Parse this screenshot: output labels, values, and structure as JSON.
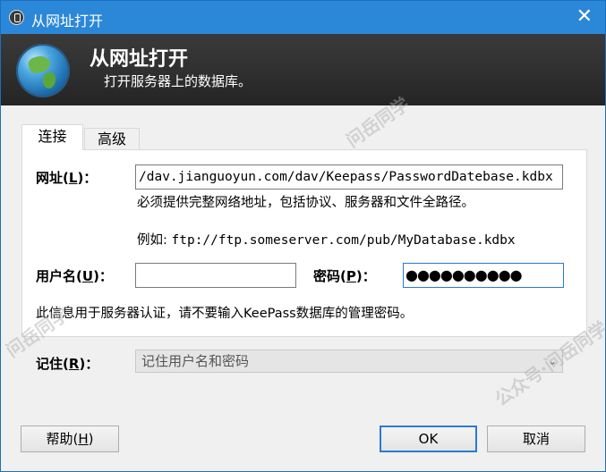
{
  "window": {
    "title": "从网址打开",
    "close_glyph": "✕"
  },
  "banner": {
    "heading": "从网址打开",
    "subheading": "打开服务器上的数据库。"
  },
  "tabs": [
    {
      "label": "连接"
    },
    {
      "label": "高级"
    }
  ],
  "form": {
    "url_label": "网址",
    "url_key": "L",
    "url_value": "/dav.jianguoyun.com/dav/Keepass/PasswordDatebase.kdbx",
    "url_hint": "必须提供完整网络地址，包括协议、服务器和文件全路径。",
    "url_example_prefix": "例如: ",
    "url_example_value": "ftp://ftp.someserver.com/pub/MyDatabase.kdbx",
    "username_label": "用户名",
    "username_key": "U",
    "username_value": "",
    "password_label": "密码",
    "password_key": "P",
    "password_mask": "●●●●●●●●●●",
    "info_text": "此信息用于服务器认证，请不要输入KeePass数据库的管理密码。",
    "remember_label": "记住",
    "remember_key": "R",
    "remember_value": "记住用户名和密码"
  },
  "buttons": {
    "help_label": "帮助",
    "help_key": "H",
    "ok_label": "OK",
    "cancel_label": "取消"
  },
  "watermark": {
    "text1": "问岳同学",
    "text2": "公众号·问岳同学"
  },
  "colors": {
    "titlebar": "#2b87d8",
    "banner": "#2e2e2e",
    "default_button_border": "#2a7ad4"
  }
}
